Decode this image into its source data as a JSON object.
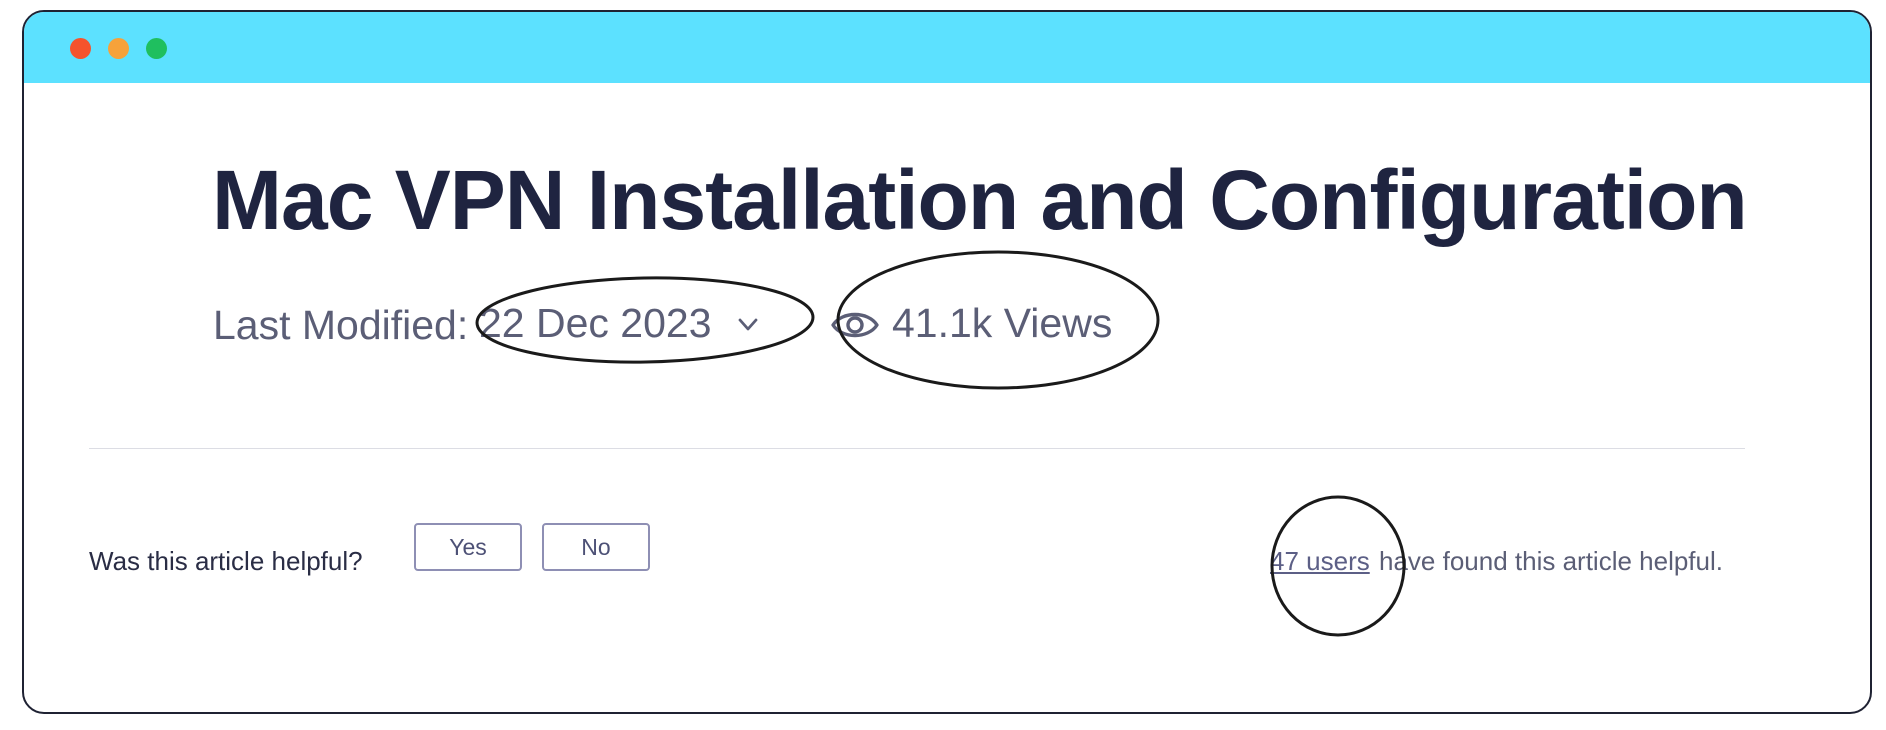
{
  "window": {
    "controls": [
      "close",
      "minimize",
      "zoom"
    ],
    "colors": {
      "titlebar": "#5ce1ff",
      "close": "#f5532d",
      "minimize": "#f6a23a",
      "zoom": "#1fbf5f"
    }
  },
  "article": {
    "title": "Mac VPN Installation and Configuration",
    "last_modified_label": "Last Modified:",
    "last_modified_date": "22 Dec 2023",
    "views": "41.1k Views"
  },
  "feedback": {
    "question": "Was this article helpful?",
    "yes_label": "Yes",
    "no_label": "No",
    "users_link": "47 users",
    "users_suffix": "have found this article helpful."
  },
  "icons": {
    "date_dropdown": "chevron-down-icon",
    "views": "eye-icon"
  }
}
